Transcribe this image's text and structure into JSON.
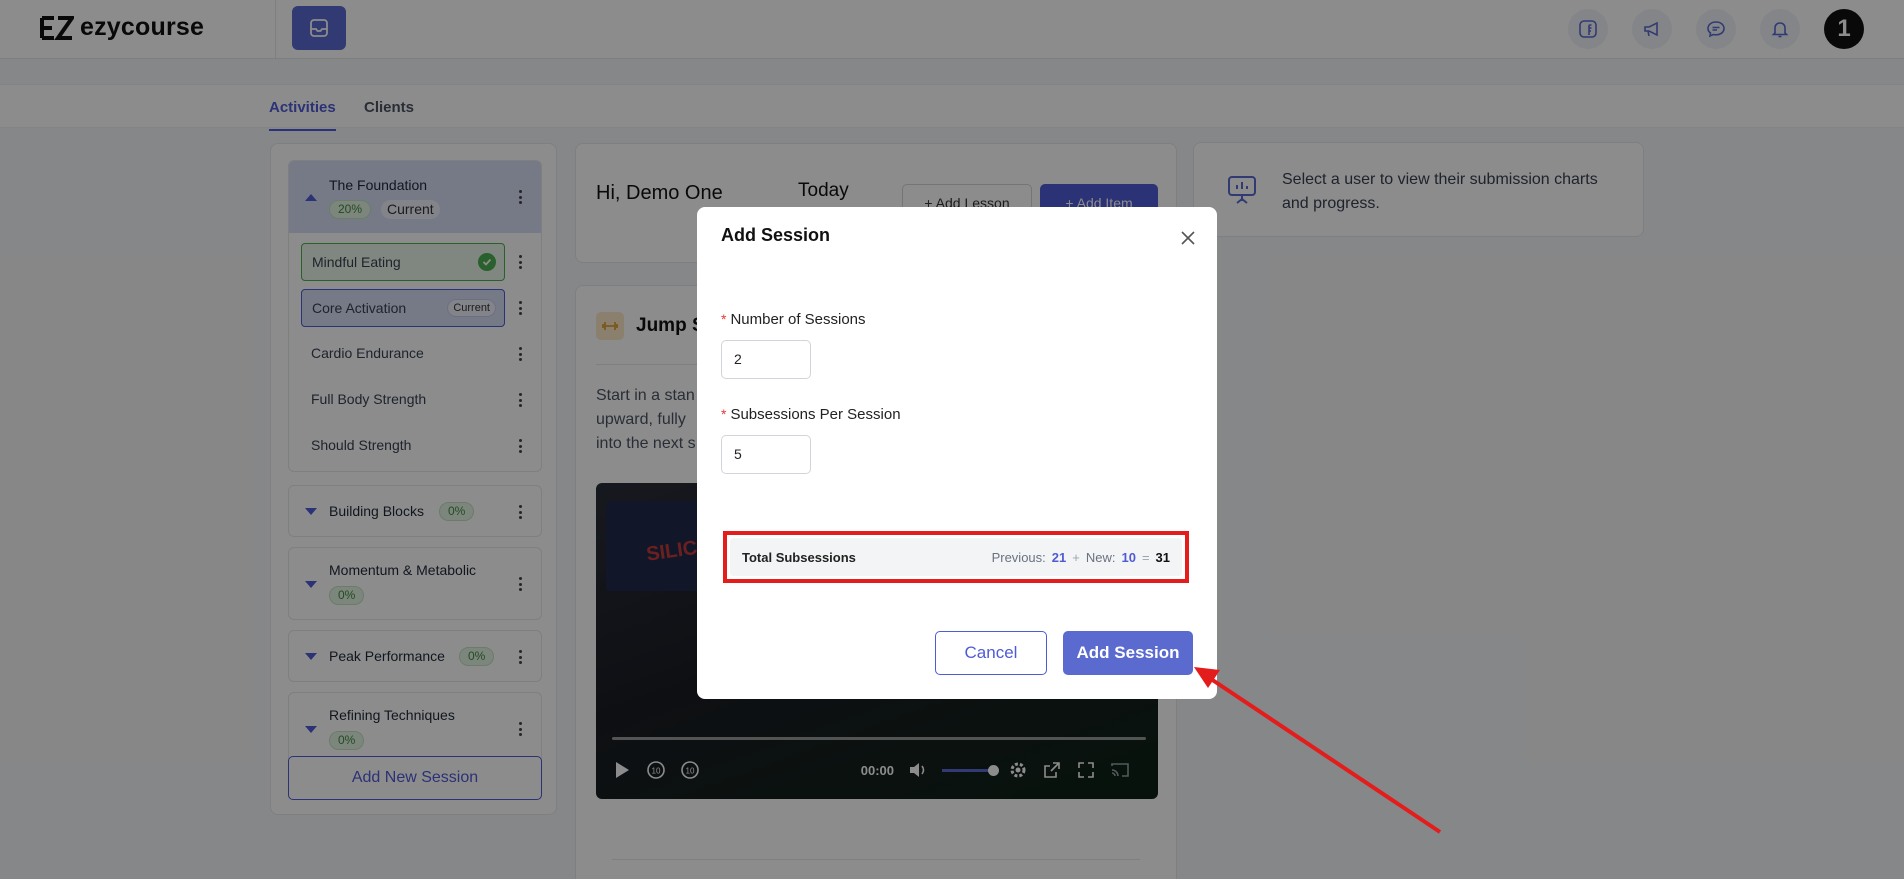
{
  "brand": {
    "name": "ezycourse"
  },
  "header": {
    "icons": [
      "facebook-icon",
      "megaphone-icon",
      "chat-icon",
      "bell-icon"
    ],
    "avatar_text": "1"
  },
  "tabs": [
    {
      "label": "Activities",
      "active": true
    },
    {
      "label": "Clients",
      "active": false
    }
  ],
  "sessions": {
    "expanded": {
      "title": "The Foundation",
      "progress": "20%",
      "status": "Current",
      "lessons": [
        {
          "label": "Mindful Eating",
          "state": "completed"
        },
        {
          "label": "Core Activation",
          "state": "current",
          "badge": "Current"
        },
        {
          "label": "Cardio Endurance",
          "state": "normal"
        },
        {
          "label": "Full Body Strength",
          "state": "normal"
        },
        {
          "label": "Should Strength",
          "state": "normal"
        }
      ]
    },
    "collapsed": [
      {
        "title": "Building Blocks",
        "progress": "0%"
      },
      {
        "title": "Momentum & Metabolic",
        "progress": "0%"
      },
      {
        "title": "Peak Performance",
        "progress": "0%"
      },
      {
        "title": "Refining Techniques",
        "progress": "0%"
      }
    ],
    "add_button": "Add New Session"
  },
  "main": {
    "greeting": "Hi, Demo One",
    "today": "Today",
    "add_lesson": "+ Add Lesson",
    "add_item": "+ Add Item",
    "exercise_title": "Jump S",
    "exercise_desc_lines": [
      "Start in a stan",
      "upward, fully",
      "into the next s"
    ],
    "video": {
      "time": "00:00",
      "banner": "SILICON VA"
    }
  },
  "right_panel": {
    "text": "Select a user to view their submission charts and progress."
  },
  "modal": {
    "title": "Add Session",
    "fields": [
      {
        "label": "Number of Sessions",
        "value": "2",
        "required": true
      },
      {
        "label": "Subsessions Per Session",
        "value": "5",
        "required": true
      }
    ],
    "totals": {
      "label": "Total Subsessions",
      "previous_label": "Previous:",
      "previous_value": "21",
      "plus": "+",
      "new_label": "New:",
      "new_value": "10",
      "equals": "=",
      "total": "31"
    },
    "cancel_label": "Cancel",
    "submit_label": "Add Session"
  },
  "colors": {
    "accent": "#4f5bd5",
    "annotation": "#e31c1c",
    "success": "#4caf50"
  }
}
